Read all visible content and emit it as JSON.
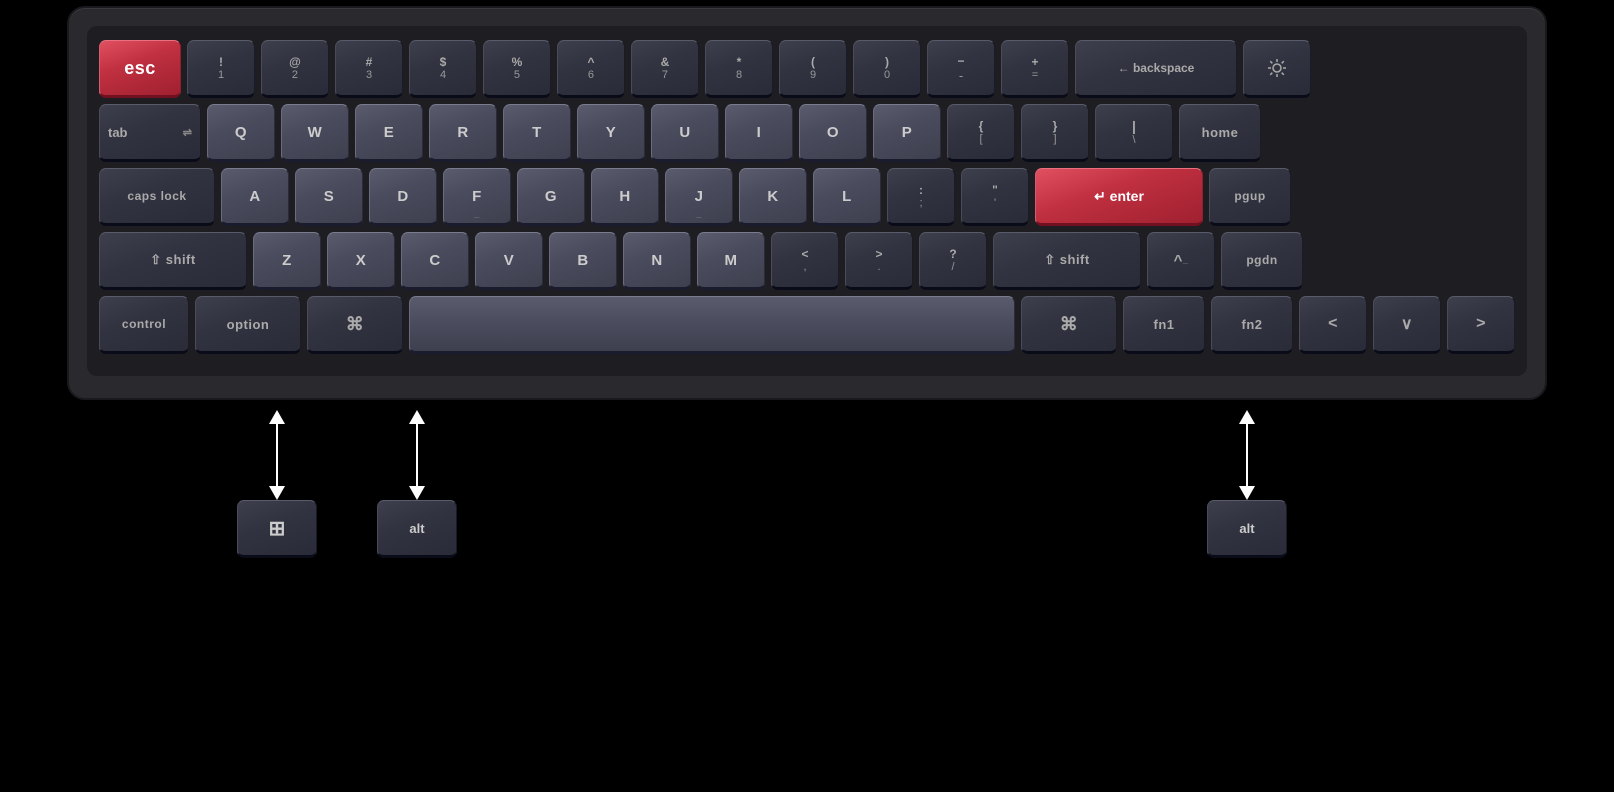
{
  "keyboard": {
    "rows": {
      "row1": {
        "keys": [
          "esc",
          "!1",
          "@2",
          "#3",
          "$4",
          "%5",
          "^6",
          "&7",
          "*8",
          "(9",
          ")0",
          "-_",
          "+=",
          "backspace",
          "light"
        ]
      },
      "row2": {
        "keys": [
          "tab",
          "Q",
          "W",
          "E",
          "R",
          "T",
          "Y",
          "U",
          "I",
          "O",
          "P",
          "{[",
          "}]",
          "\\|",
          "home"
        ]
      },
      "row3": {
        "keys": [
          "caps lock",
          "A",
          "S",
          "D",
          "F",
          "G",
          "H",
          "J",
          "K",
          "L",
          ";:",
          "\"'",
          "enter",
          "pgup"
        ]
      },
      "row4": {
        "keys": [
          "shift",
          "Z",
          "X",
          "C",
          "V",
          "B",
          "N",
          "M",
          "<,",
          ">.",
          "?/",
          "shift_r",
          "^",
          "pgdn"
        ]
      },
      "row5": {
        "keys": [
          "control",
          "option",
          "cmd",
          "space",
          "cmd_r",
          "fn1",
          "fn2",
          "left",
          "down",
          "right"
        ]
      }
    },
    "swapLeft": [
      "win",
      "alt"
    ],
    "swapRight": [
      "alt"
    ]
  }
}
